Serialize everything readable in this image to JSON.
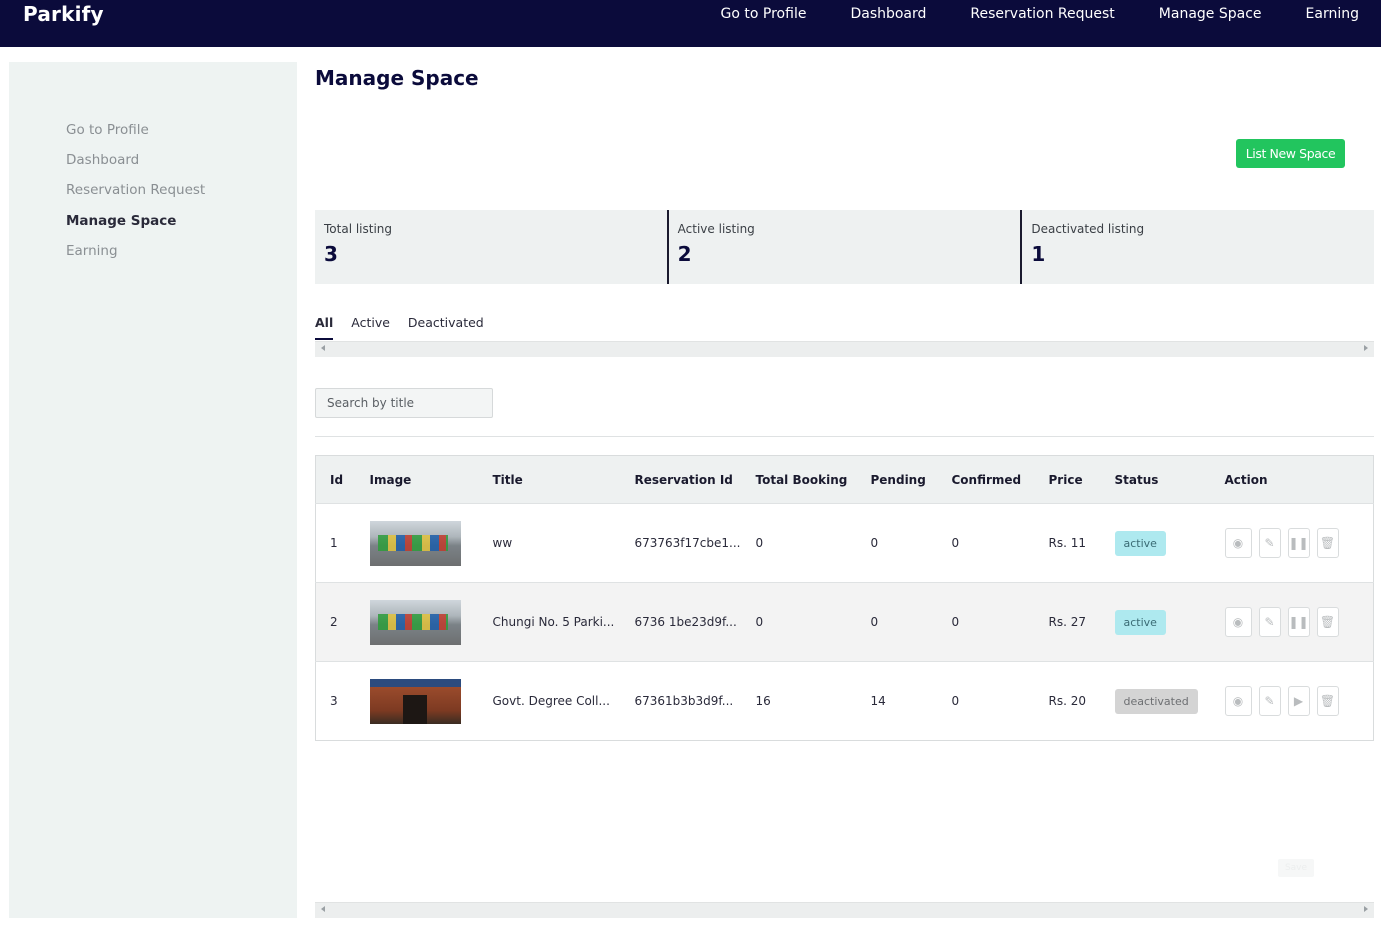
{
  "app": {
    "brand": "Parkify"
  },
  "topnav": [
    "Go to Profile",
    "Dashboard",
    "Reservation Request",
    "Manage Space",
    "Earning"
  ],
  "sidebar": {
    "items": [
      {
        "label": "Go to Profile",
        "active": false
      },
      {
        "label": "Dashboard",
        "active": false
      },
      {
        "label": "Reservation Request",
        "active": false
      },
      {
        "label": "Manage Space",
        "active": true
      },
      {
        "label": "Earning",
        "active": false
      }
    ]
  },
  "page": {
    "title": "Manage Space",
    "list_new_label": "List New Space"
  },
  "stats": [
    {
      "label": "Total listing",
      "value": "3"
    },
    {
      "label": "Active listing",
      "value": "2"
    },
    {
      "label": "Deactivated listing",
      "value": "1"
    }
  ],
  "tabs": [
    {
      "label": "All",
      "active": true
    },
    {
      "label": "Active",
      "active": false
    },
    {
      "label": "Deactivated",
      "active": false
    }
  ],
  "search": {
    "placeholder": "Search by title"
  },
  "table": {
    "headers": [
      "Id",
      "Image",
      "Title",
      "Reservation Id",
      "Total Booking",
      "Pending",
      "Confirmed",
      "Price",
      "Status",
      "Action"
    ],
    "rows": [
      {
        "id": "1",
        "image": "street",
        "title": "ww",
        "reservation_id": "673763f17cbe1...",
        "total_booking": "0",
        "pending": "0",
        "confirmed": "0",
        "price": "Rs. 11",
        "status": "active",
        "toggle_icon": "pause-icon"
      },
      {
        "id": "2",
        "image": "street",
        "title": "Chungi No. 5 Parki...",
        "reservation_id": "6736 1be23d9f...",
        "total_booking": "0",
        "pending": "0",
        "confirmed": "0",
        "price": "Rs. 27",
        "status": "active",
        "toggle_icon": "pause-icon"
      },
      {
        "id": "3",
        "image": "building",
        "title": "Govt. Degree Coll...",
        "reservation_id": "67361b3b3d9f...",
        "total_booking": "16",
        "pending": "14",
        "confirmed": "0",
        "price": "Rs. 20",
        "status": "deactivated",
        "toggle_icon": "play-icon"
      }
    ]
  },
  "footer_button": {
    "label": "Save"
  }
}
